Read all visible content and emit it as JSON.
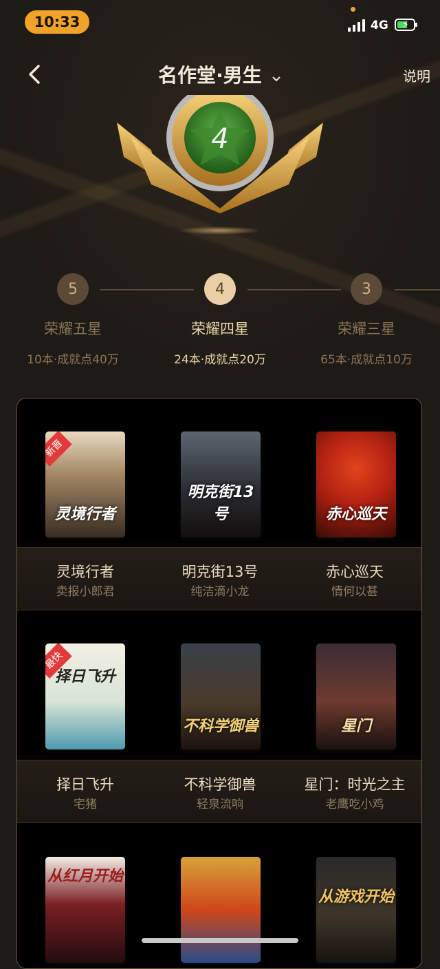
{
  "status_bar": {
    "time": "10:33",
    "network": "4G"
  },
  "header": {
    "title": "名作堂·男生",
    "help_label": "说明"
  },
  "badge": {
    "star_number": "4"
  },
  "levels": [
    {
      "number": "5",
      "name": "荣耀五星",
      "desc": "10本·成就点40万",
      "active": false
    },
    {
      "number": "4",
      "name": "荣耀四星",
      "desc": "24本·成就点20万",
      "active": true
    },
    {
      "number": "3",
      "name": "荣耀三星",
      "desc": "65本·成就点10万",
      "active": false
    }
  ],
  "books": [
    {
      "title": "灵境行者",
      "author": "卖报小郎君",
      "cover_text": "灵境行者",
      "tag": "新晋"
    },
    {
      "title": "明克街13号",
      "author": "纯洁滴小龙",
      "cover_text": "明克街13号",
      "tag": ""
    },
    {
      "title": "赤心巡天",
      "author": "情何以甚",
      "cover_text": "赤心巡天",
      "tag": ""
    },
    {
      "title": "择日飞升",
      "author": "宅猪",
      "cover_text": "择日飞升",
      "tag": "最快"
    },
    {
      "title": "不科学御兽",
      "author": "轻泉流响",
      "cover_text": "不科学御兽",
      "tag": ""
    },
    {
      "title": "星门：时光之主",
      "author": "老鹰吃小鸡",
      "cover_text": "星门",
      "tag": ""
    },
    {
      "title": "",
      "author": "",
      "cover_text": "从红月开始",
      "tag": ""
    },
    {
      "title": "",
      "author": "",
      "cover_text": "",
      "tag": ""
    },
    {
      "title": "",
      "author": "",
      "cover_text": "从游戏开始",
      "tag": ""
    }
  ]
}
